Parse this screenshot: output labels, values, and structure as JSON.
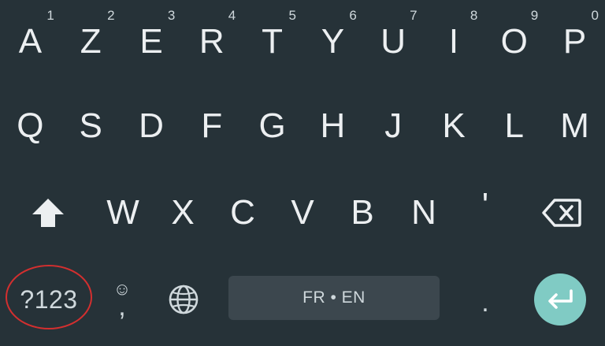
{
  "keyboard": {
    "row1": [
      {
        "label": "A",
        "hint": "1"
      },
      {
        "label": "Z",
        "hint": "2"
      },
      {
        "label": "E",
        "hint": "3"
      },
      {
        "label": "R",
        "hint": "4"
      },
      {
        "label": "T",
        "hint": "5"
      },
      {
        "label": "Y",
        "hint": "6"
      },
      {
        "label": "U",
        "hint": "7"
      },
      {
        "label": "I",
        "hint": "8"
      },
      {
        "label": "O",
        "hint": "9"
      },
      {
        "label": "P",
        "hint": "0"
      }
    ],
    "row2": [
      "Q",
      "S",
      "D",
      "F",
      "G",
      "H",
      "J",
      "K",
      "L",
      "M"
    ],
    "row3": [
      "W",
      "X",
      "C",
      "V",
      "B",
      "N",
      "'"
    ],
    "row4": {
      "symbols_label": "?123",
      "emoji_glyph": "☺",
      "comma_label": ",",
      "space_label": "FR • EN",
      "period_label": "."
    },
    "icons": {
      "shift": "shift-arrow-icon",
      "backspace": "backspace-icon",
      "globe": "globe-icon",
      "enter": "enter-return-icon"
    },
    "colors": {
      "background": "#263238",
      "key_text": "#eceff1",
      "space_bar": "#3c474e",
      "enter_accent": "#80cbc4",
      "highlight_circle": "#d32f2f"
    }
  }
}
